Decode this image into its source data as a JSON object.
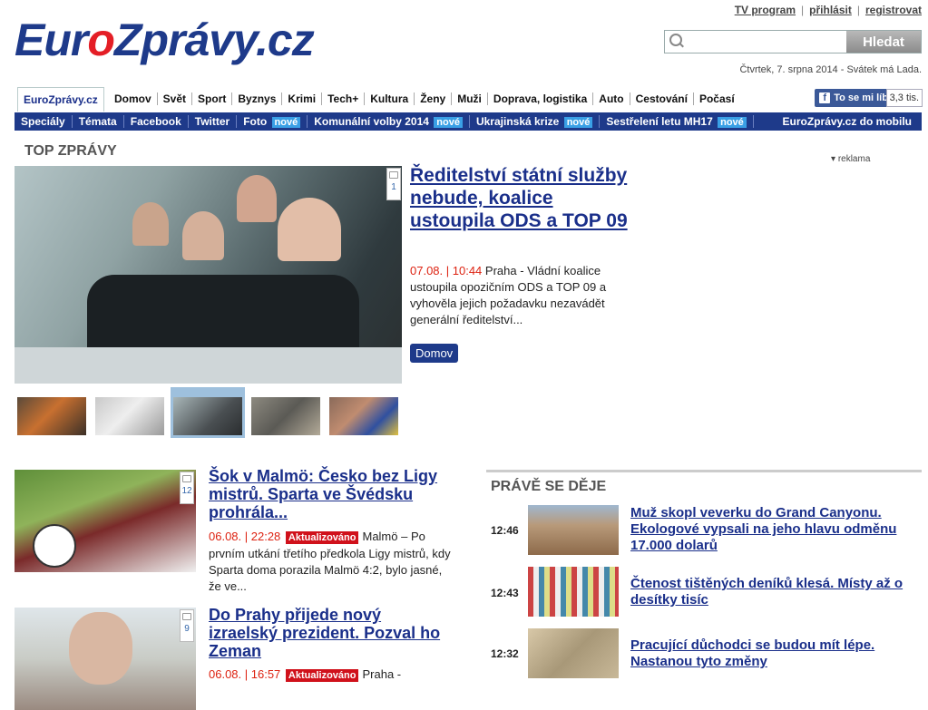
{
  "header": {
    "logo_text": "EuroZprávy.cz",
    "logo_parts": [
      "Eur",
      "o",
      "Zprávy.cz"
    ],
    "top_links": [
      "TV program",
      "přihlásit",
      "registrovat"
    ],
    "search": {
      "placeholder": "",
      "button_label": "Hledat"
    },
    "dateline": "Čtvrtek, 7. srpna 2014 - Svátek má Lada."
  },
  "nav": {
    "home_tab": "EuroZprávy.cz",
    "items": [
      "Domov",
      "Svět",
      "Sport",
      "Byznys",
      "Krimi",
      "Tech+",
      "Kultura",
      "Ženy",
      "Muži",
      "Doprava, logistika",
      "Auto",
      "Cestování",
      "Počasí"
    ],
    "facebook_like": "To se mi líbí",
    "facebook_count": "3,3 tis."
  },
  "subnav": {
    "items": [
      {
        "label": "Speciály",
        "new": ""
      },
      {
        "label": "Témata",
        "new": ""
      },
      {
        "label": "Facebook",
        "new": ""
      },
      {
        "label": "Twitter",
        "new": ""
      },
      {
        "label": "Foto",
        "new": "nové"
      },
      {
        "label": "Komunální volby 2014",
        "new": "nové"
      },
      {
        "label": "Ukrajinská krize",
        "new": "nové"
      },
      {
        "label": "Sestřelení letu MH17",
        "new": "nové"
      }
    ],
    "mobile": "EuroZprávy.cz do mobilu"
  },
  "top": {
    "section_title": "TOP ZPRÁVY",
    "ad_label": "reklama",
    "comment_count": "1",
    "headline": "Ředitelství státní služby nebude, koalice ustoupila ODS a TOP 09",
    "date": "07.08. | 10:44",
    "perex": "Praha - Vládní koalice ustoupila opozičním ODS a TOP 09 a vyhověla jejich požadavku nezavádět generální ředitelství...",
    "tag": "Domov"
  },
  "stories": [
    {
      "comments": "12",
      "title": "Šok v Malmö: Česko bez Ligy mistrů. Sparta ve Švédsku prohrála...",
      "date": "06.08. | 22:28",
      "badge": "Aktualizováno",
      "perex": "Malmö – Po prvním utkání třetího předkola Ligy mistrů, kdy Sparta doma porazila Malmö 4:2, bylo jasné, že ve..."
    },
    {
      "comments": "9",
      "title": "Do Prahy přijede nový izraelský prezident. Pozval ho Zeman",
      "date": "06.08. | 16:57",
      "badge": "Aktualizováno",
      "perex": "Praha -"
    }
  ],
  "live": {
    "section_title": "PRÁVĚ SE DĚJE",
    "items": [
      {
        "time": "12:46",
        "title": "Muž skopl veverku do Grand Canyonu. Ekologové vypsali na jeho hlavu odměnu 17.000 dolarů"
      },
      {
        "time": "12:43",
        "title": "Čtenost tištěných deníků klesá. Místy až o desítky tisíc"
      },
      {
        "time": "12:32",
        "title": "Pracující důchodci se budou mít lépe. Nastanou tyto změny"
      }
    ]
  },
  "colors": {
    "brand_blue": "#1e3a8a",
    "brand_red": "#e41e26",
    "new_badge": "#3aa0e6",
    "update_badge": "#d0111b"
  }
}
